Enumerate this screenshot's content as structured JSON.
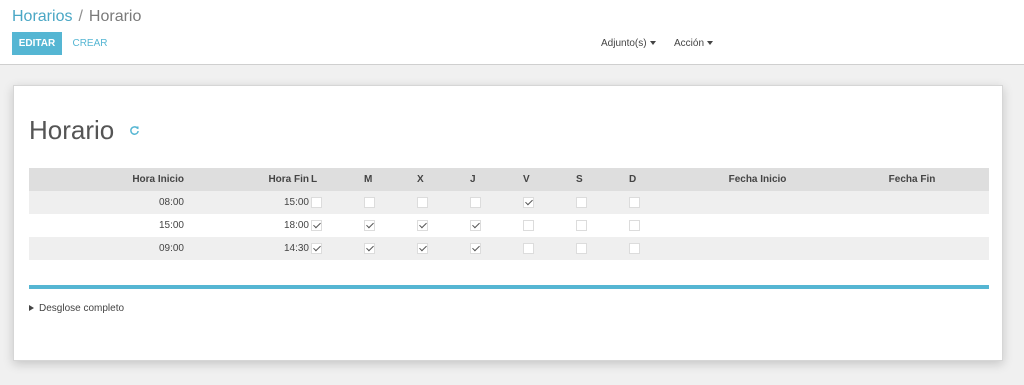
{
  "breadcrumb": {
    "parent": "Horarios",
    "separator": "/",
    "current": "Horario"
  },
  "toolbar": {
    "edit_label": "EDITAR",
    "create_label": "CREAR",
    "attachments_label": "Adjunto(s)",
    "action_label": "Acción"
  },
  "colors": {
    "accent": "#55b6d3",
    "link": "#4aa7c5"
  },
  "form": {
    "title": "Horario",
    "refresh_icon": "refresh-icon",
    "table": {
      "headers": [
        "Hora Inicio",
        "Hora Fin",
        "L",
        "M",
        "X",
        "J",
        "V",
        "S",
        "D",
        "Fecha Inicio",
        "Fecha Fin"
      ],
      "rows": [
        {
          "start": "08:00",
          "end": "15:00",
          "days": [
            false,
            false,
            false,
            false,
            true,
            false,
            false
          ],
          "date_start": "",
          "date_end": ""
        },
        {
          "start": "15:00",
          "end": "18:00",
          "days": [
            true,
            true,
            true,
            true,
            false,
            false,
            false
          ],
          "date_start": "",
          "date_end": ""
        },
        {
          "start": "09:00",
          "end": "14:30",
          "days": [
            true,
            true,
            true,
            true,
            false,
            false,
            false
          ],
          "date_start": "",
          "date_end": ""
        }
      ]
    },
    "breakdown_label": "Desglose completo"
  }
}
